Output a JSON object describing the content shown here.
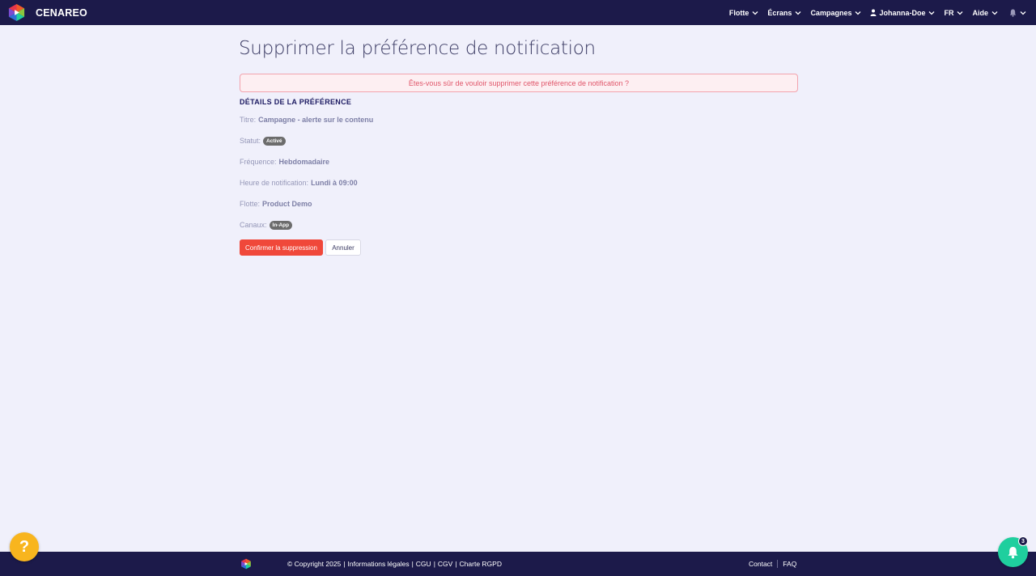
{
  "colors": {
    "navbar_bg": "#1c1a4a",
    "page_bg": "#f0f0fb",
    "danger": "#f0483a",
    "help": "#f8b51e",
    "notification_fab": "#1fcf9e"
  },
  "navbar": {
    "brand": "CENAREO",
    "logo_icon": "cenareo-logo",
    "items": [
      {
        "label": "Flotte"
      },
      {
        "label": "Écrans"
      },
      {
        "label": "Campagnes"
      },
      {
        "label": "Johanna-Doe",
        "icon": "user-icon"
      },
      {
        "label": "FR"
      },
      {
        "label": "Aide"
      }
    ],
    "bell_icon": "bell-icon"
  },
  "main": {
    "title": "Supprimer la préférence de notification",
    "alert": "Êtes-vous sûr de vouloir supprimer cette préférence de notification ?",
    "section_title": "DÉTAILS DE LA PRÉFÉRENCE",
    "details": {
      "titre_label": "Titre:",
      "titre_value": "Campagne - alerte sur le contenu",
      "statut_label": "Statut:",
      "statut_badge": "Activé",
      "frequence_label": "Fréquence:",
      "frequence_value": "Hebdomadaire",
      "heure_label": "Heure de notification:",
      "heure_value": "Lundi à 09:00",
      "flotte_label": "Flotte:",
      "flotte_value": "Product Demo",
      "canaux_label": "Canaux:",
      "canaux_badge": "In-App"
    },
    "confirm_button": "Confirmer la suppression",
    "cancel_button": "Annuler"
  },
  "footer": {
    "copyright": "© Copyright 2025",
    "links": [
      "Informations légales",
      "CGU",
      "CGV",
      "Charte RGPD"
    ],
    "separator": "|",
    "contact": "Contact",
    "faq": "FAQ"
  },
  "floating": {
    "help_label": "?",
    "notification_count": "3"
  }
}
